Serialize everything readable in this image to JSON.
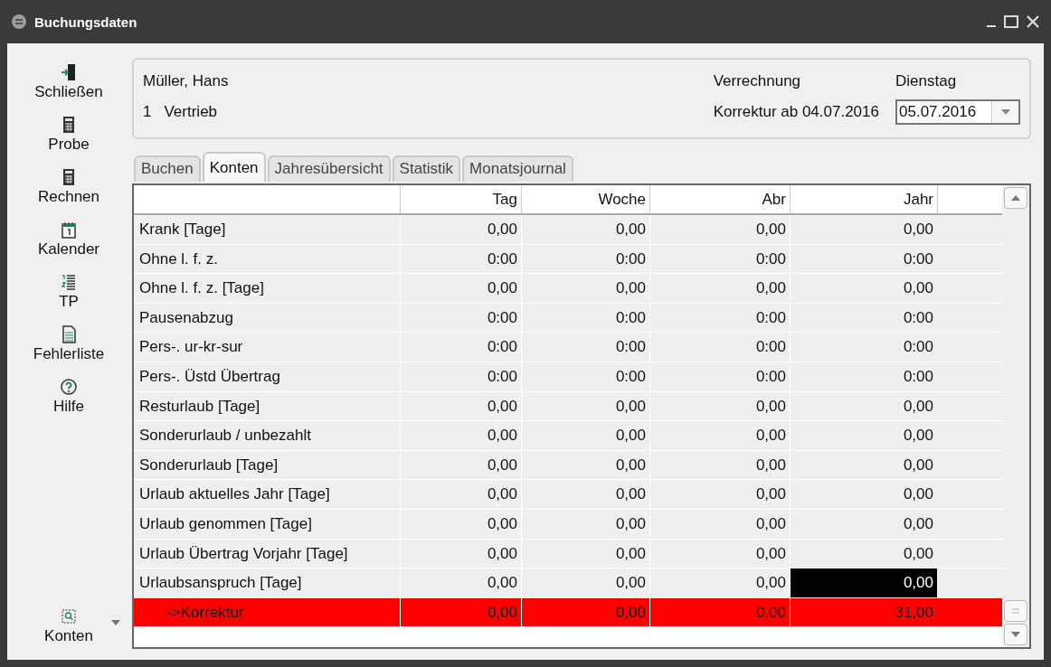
{
  "window": {
    "title": "Buchungsdaten"
  },
  "sidebar": {
    "items": [
      {
        "label": "Schließen",
        "kind": "button"
      },
      {
        "label": "Probe",
        "kind": "button"
      },
      {
        "label": "Rechnen",
        "kind": "button"
      },
      {
        "label": "Kalender",
        "kind": "button"
      },
      {
        "label": "TP",
        "kind": "button"
      },
      {
        "label": "Fehlerliste",
        "kind": "button"
      },
      {
        "label": "Hilfe",
        "kind": "button"
      },
      {
        "label": "Konten",
        "kind": "dropdown"
      }
    ]
  },
  "header": {
    "employee": "Müller, Hans",
    "department_number": "1",
    "department": "Vertrieb",
    "mode": "Verrechnung",
    "correction": "Korrektur ab 04.07.2016",
    "weekday": "Dienstag",
    "date": "05.07.2016"
  },
  "tabs": [
    {
      "label": "Buchen",
      "selected": false
    },
    {
      "label": "Konten",
      "selected": true
    },
    {
      "label": "Jahresübersicht",
      "selected": false
    },
    {
      "label": "Statistik",
      "selected": false
    },
    {
      "label": "Monatsjournal",
      "selected": false
    }
  ],
  "table": {
    "columns": [
      "Tag",
      "Woche",
      "Abr",
      "Jahr"
    ],
    "rows": [
      {
        "kind": "account",
        "label": "Krank [Tage]",
        "cells": [
          {
            "text": "0,00",
            "selected": false
          },
          {
            "text": "0,00",
            "selected": false
          },
          {
            "text": "0,00",
            "selected": false
          },
          {
            "text": "0,00",
            "selected": false
          }
        ]
      },
      {
        "kind": "account",
        "label": "Ohne l. f. z.",
        "cells": [
          {
            "text": "0:00",
            "selected": false
          },
          {
            "text": "0:00",
            "selected": false
          },
          {
            "text": "0:00",
            "selected": false
          },
          {
            "text": "0:00",
            "selected": false
          }
        ]
      },
      {
        "kind": "account",
        "label": "Ohne l. f. z. [Tage]",
        "cells": [
          {
            "text": "0,00",
            "selected": false
          },
          {
            "text": "0,00",
            "selected": false
          },
          {
            "text": "0,00",
            "selected": false
          },
          {
            "text": "0,00",
            "selected": false
          }
        ]
      },
      {
        "kind": "account",
        "label": "Pausenabzug",
        "cells": [
          {
            "text": "0:00",
            "selected": false
          },
          {
            "text": "0:00",
            "selected": false
          },
          {
            "text": "0:00",
            "selected": false
          },
          {
            "text": "0:00",
            "selected": false
          }
        ]
      },
      {
        "kind": "account",
        "label": "Pers-. ur-kr-sur",
        "cells": [
          {
            "text": "0:00",
            "selected": false
          },
          {
            "text": "0:00",
            "selected": false
          },
          {
            "text": "0:00",
            "selected": false
          },
          {
            "text": "0:00",
            "selected": false
          }
        ]
      },
      {
        "kind": "account",
        "label": "Pers-. Üstd Übertrag",
        "cells": [
          {
            "text": "0:00",
            "selected": false
          },
          {
            "text": "0:00",
            "selected": false
          },
          {
            "text": "0:00",
            "selected": false
          },
          {
            "text": "0:00",
            "selected": false
          }
        ]
      },
      {
        "kind": "account",
        "label": "Resturlaub [Tage]",
        "cells": [
          {
            "text": "0,00",
            "selected": false
          },
          {
            "text": "0,00",
            "selected": false
          },
          {
            "text": "0,00",
            "selected": false
          },
          {
            "text": "0,00",
            "selected": false
          }
        ]
      },
      {
        "kind": "account",
        "label": "Sonderurlaub / unbezahlt",
        "cells": [
          {
            "text": "0,00",
            "selected": false
          },
          {
            "text": "0,00",
            "selected": false
          },
          {
            "text": "0,00",
            "selected": false
          },
          {
            "text": "0,00",
            "selected": false
          }
        ]
      },
      {
        "kind": "account",
        "label": "Sonderurlaub [Tage]",
        "cells": [
          {
            "text": "0,00",
            "selected": false
          },
          {
            "text": "0,00",
            "selected": false
          },
          {
            "text": "0,00",
            "selected": false
          },
          {
            "text": "0,00",
            "selected": false
          }
        ]
      },
      {
        "kind": "account",
        "label": "Urlaub aktuelles Jahr [Tage]",
        "cells": [
          {
            "text": "0,00",
            "selected": false
          },
          {
            "text": "0,00",
            "selected": false
          },
          {
            "text": "0,00",
            "selected": false
          },
          {
            "text": "0,00",
            "selected": false
          }
        ]
      },
      {
        "kind": "account",
        "label": "Urlaub genommen [Tage]",
        "cells": [
          {
            "text": "0,00",
            "selected": false
          },
          {
            "text": "0,00",
            "selected": false
          },
          {
            "text": "0,00",
            "selected": false
          },
          {
            "text": "0,00",
            "selected": false
          }
        ]
      },
      {
        "kind": "account",
        "label": "Urlaub Übertrag Vorjahr [Tage]",
        "cells": [
          {
            "text": "0,00",
            "selected": false
          },
          {
            "text": "0,00",
            "selected": false
          },
          {
            "text": "0,00",
            "selected": false
          },
          {
            "text": "0,00",
            "selected": false
          }
        ]
      },
      {
        "kind": "account",
        "label": "Urlaubsanspruch [Tage]",
        "cells": [
          {
            "text": "0,00",
            "selected": false
          },
          {
            "text": "0,00",
            "selected": false
          },
          {
            "text": "0,00",
            "selected": false
          },
          {
            "text": "0,00",
            "selected": true
          }
        ]
      },
      {
        "kind": "correction",
        "label": "->Korrektur",
        "cells": [
          {
            "text": "0,00",
            "selected": false
          },
          {
            "text": "0,00",
            "selected": false
          },
          {
            "text": "0,00",
            "selected": false
          },
          {
            "text": "31,00",
            "selected": false
          }
        ]
      }
    ]
  }
}
